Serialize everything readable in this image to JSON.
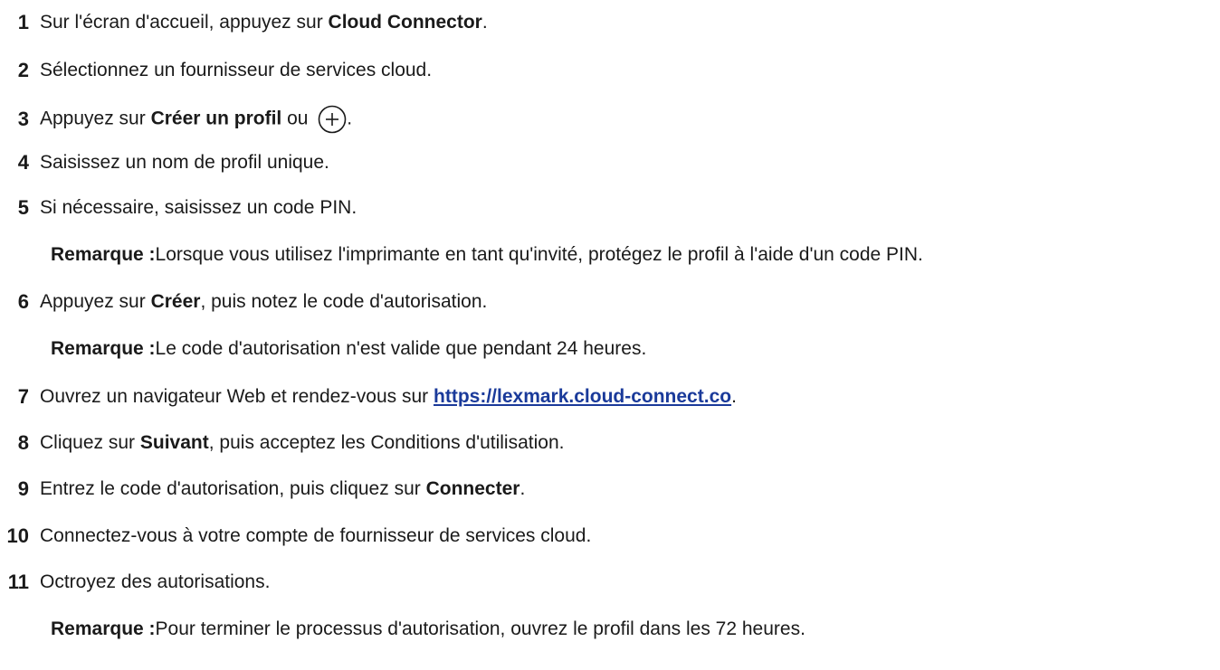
{
  "steps": [
    {
      "num": "1",
      "pre": "Sur l'écran d'accueil, appuyez sur ",
      "bold": "Cloud Connector",
      "post": "."
    },
    {
      "num": "2",
      "text": "Sélectionnez un fournisseur de services cloud."
    },
    {
      "num": "3",
      "pre": "Appuyez sur ",
      "bold": "Créer un profil",
      "mid": " ou ",
      "post": ".",
      "icon": "plus-circle-icon"
    },
    {
      "num": "4",
      "text": "Saisissez un nom de profil unique."
    },
    {
      "num": "5",
      "text": "Si nécessaire, saisissez un code PIN."
    },
    {
      "num": "6",
      "pre": "Appuyez sur ",
      "bold": "Créer",
      "post": ", puis notez le code d'autorisation."
    },
    {
      "num": "7",
      "pre": "Ouvrez un navigateur Web et rendez-vous sur ",
      "link": "https://lexmark.cloud-connect.co",
      "post": "."
    },
    {
      "num": "8",
      "pre": "Cliquez sur ",
      "bold": "Suivant",
      "post": ", puis acceptez les Conditions d'utilisation."
    },
    {
      "num": "9",
      "pre": "Entrez le code d'autorisation, puis cliquez sur ",
      "bold": "Connecter",
      "post": "."
    },
    {
      "num": "10",
      "text": "Connectez-vous à votre compte de fournisseur de services cloud."
    },
    {
      "num": "11",
      "text": "Octroyez des autorisations."
    }
  ],
  "notes": {
    "label": "Remarque :",
    "n5": " Lorsque vous utilisez l'imprimante en tant qu'invité, protégez le profil à l'aide d'un code PIN.",
    "n6": " Le code d'autorisation n'est valide que pendant 24 heures.",
    "n11": " Pour terminer le processus d'autorisation, ouvrez le profil dans les 72 heures."
  },
  "colors": {
    "text": "#1a1a1a",
    "link": "#1a3a9a"
  }
}
